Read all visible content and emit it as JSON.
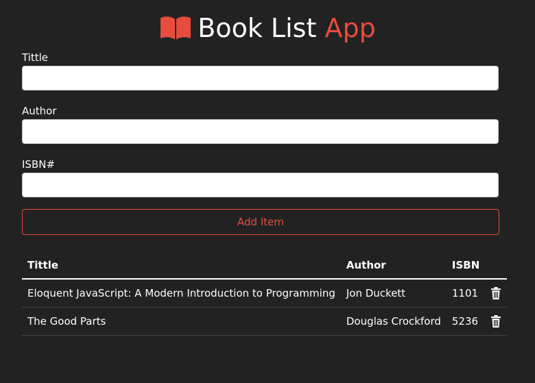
{
  "header": {
    "title_main": "Book List",
    "title_accent": "App",
    "logo_icon": "open-book-icon",
    "accent_color": "#e74c3c"
  },
  "form": {
    "title_label": "Tittle",
    "title_value": "",
    "author_label": "Author",
    "author_value": "",
    "isbn_label": "ISBN#",
    "isbn_value": "",
    "submit_label": "Add Item"
  },
  "table": {
    "headers": {
      "title": "Tittle",
      "author": "Author",
      "isbn": "ISBN"
    },
    "rows": [
      {
        "title": "Eloquent JavaScript: A Modern Introduction to Programming",
        "author": "Jon Duckett",
        "isbn": "1101",
        "action_icon": "trash-icon"
      },
      {
        "title": "The Good Parts",
        "author": "Douglas Crockford",
        "isbn": "5236",
        "action_icon": "trash-icon"
      }
    ]
  }
}
